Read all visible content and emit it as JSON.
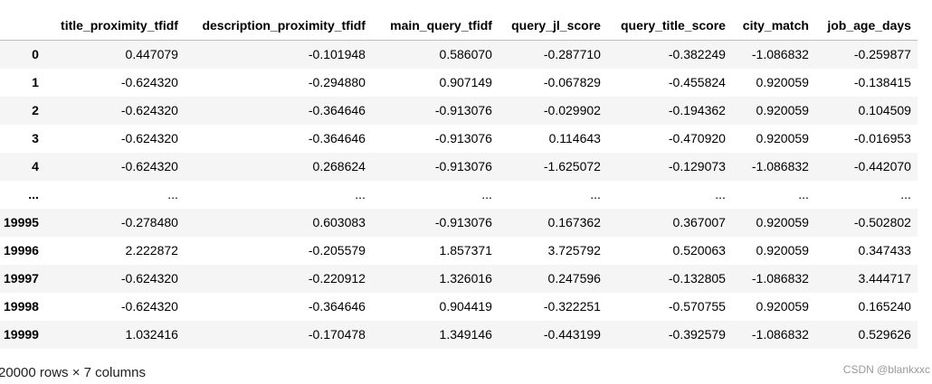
{
  "table": {
    "columns": [
      "",
      "title_proximity_tfidf",
      "description_proximity_tfidf",
      "main_query_tfidf",
      "query_jl_score",
      "query_title_score",
      "city_match",
      "job_age_days"
    ],
    "rows": [
      [
        "0",
        "0.447079",
        "-0.101948",
        "0.586070",
        "-0.287710",
        "-0.382249",
        "-1.086832",
        "-0.259877"
      ],
      [
        "1",
        "-0.624320",
        "-0.294880",
        "0.907149",
        "-0.067829",
        "-0.455824",
        "0.920059",
        "-0.138415"
      ],
      [
        "2",
        "-0.624320",
        "-0.364646",
        "-0.913076",
        "-0.029902",
        "-0.194362",
        "0.920059",
        "0.104509"
      ],
      [
        "3",
        "-0.624320",
        "-0.364646",
        "-0.913076",
        "0.114643",
        "-0.470920",
        "0.920059",
        "-0.016953"
      ],
      [
        "4",
        "-0.624320",
        "0.268624",
        "-0.913076",
        "-1.625072",
        "-0.129073",
        "-1.086832",
        "-0.442070"
      ],
      [
        "...",
        "...",
        "...",
        "...",
        "...",
        "...",
        "...",
        "..."
      ],
      [
        "19995",
        "-0.278480",
        "0.603083",
        "-0.913076",
        "0.167362",
        "0.367007",
        "0.920059",
        "-0.502802"
      ],
      [
        "19996",
        "2.222872",
        "-0.205579",
        "1.857371",
        "3.725792",
        "0.520063",
        "0.920059",
        "0.347433"
      ],
      [
        "19997",
        "-0.624320",
        "-0.220912",
        "1.326016",
        "0.247596",
        "-0.132805",
        "-1.086832",
        "3.444717"
      ],
      [
        "19998",
        "-0.624320",
        "-0.364646",
        "0.904419",
        "-0.322251",
        "-0.570755",
        "0.920059",
        "0.165240"
      ],
      [
        "19999",
        "1.032416",
        "-0.170478",
        "1.349146",
        "-0.443199",
        "-0.392579",
        "-1.086832",
        "0.529626"
      ]
    ]
  },
  "footer": {
    "shape": "20000 rows × 7 columns"
  },
  "watermark": "CSDN @blankxxc"
}
